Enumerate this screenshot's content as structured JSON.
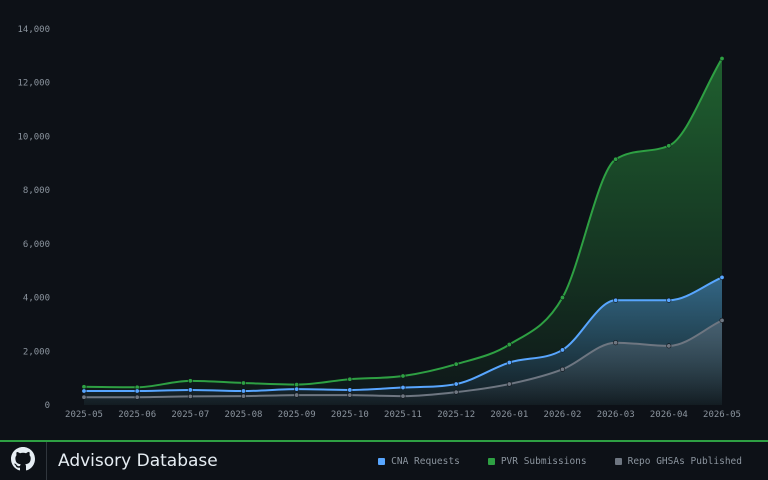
{
  "chart_data": {
    "type": "area",
    "categories": [
      "2025-05",
      "2025-06",
      "2025-07",
      "2025-08",
      "2025-09",
      "2025-10",
      "2025-11",
      "2025-12",
      "2026-01",
      "2026-02",
      "2026-03",
      "2026-04",
      "2026-05"
    ],
    "ylim": [
      0,
      14000
    ],
    "yticks": [
      "0",
      "2,000",
      "4,000",
      "6,000",
      "8,000",
      "10,000",
      "12,000",
      "14,000"
    ],
    "ytick_values": [
      0,
      2000,
      4000,
      6000,
      8000,
      10000,
      12000,
      14000
    ],
    "grid": false,
    "legend_position": "bottom-right",
    "series": [
      {
        "name": "PVR Submissions",
        "color": "#2ea043",
        "values": [
          680,
          660,
          900,
          820,
          760,
          960,
          1080,
          1520,
          2250,
          4000,
          9150,
          9650,
          12900
        ]
      },
      {
        "name": "CNA Requests",
        "color": "#58a6ff",
        "values": [
          520,
          520,
          560,
          520,
          590,
          560,
          650,
          780,
          1580,
          2050,
          3900,
          3900,
          4750
        ]
      },
      {
        "name": "Repo GHSAs Published",
        "color": "#6e7681",
        "values": [
          290,
          290,
          320,
          330,
          370,
          370,
          330,
          480,
          780,
          1330,
          2320,
          2200,
          3150
        ]
      }
    ]
  },
  "footer": {
    "title": "Advisory Database",
    "logo_icon": "github-icon",
    "legend": [
      {
        "label": "CNA Requests",
        "color": "#58a6ff"
      },
      {
        "label": "PVR Submissions",
        "color": "#2ea043"
      },
      {
        "label": "Repo GHSAs Published",
        "color": "#6e7681"
      }
    ]
  }
}
